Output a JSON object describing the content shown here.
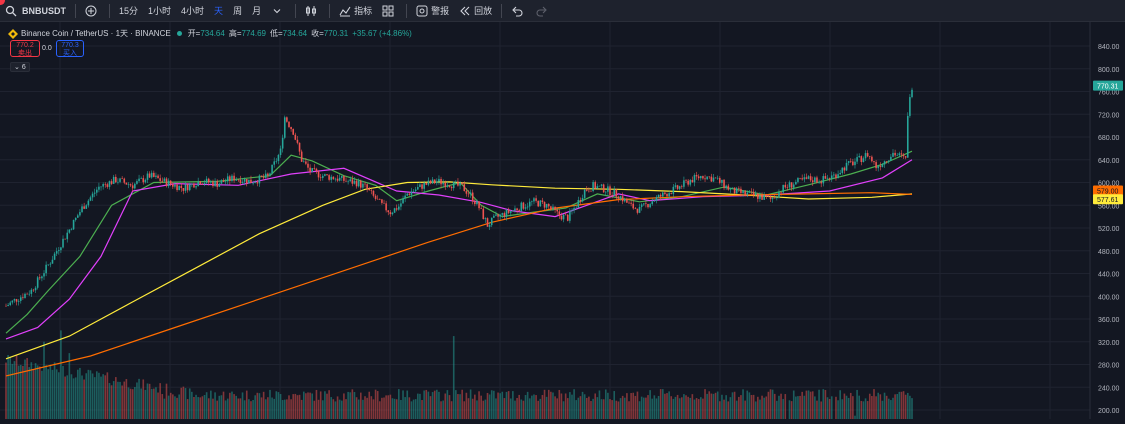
{
  "toolbar": {
    "symbol": "BNBUSDT",
    "intervals": [
      "15分",
      "1小时",
      "4小时",
      "天",
      "周",
      "月"
    ],
    "active_interval": "天",
    "indicators_label": "指标",
    "alert_label": "警报",
    "replay_label": "回放",
    "icons": [
      "search-icon",
      "add-compare-icon",
      "chevron-down-icon",
      "chart-type-icon",
      "indicators-icon",
      "layout-icon",
      "alert-icon",
      "replay-icon",
      "undo-icon",
      "redo-icon"
    ]
  },
  "legend": {
    "title": "Binance Coin / TetherUS · 1天 · BINANCE",
    "open_label": "开=",
    "open": "734.64",
    "high_label": "高=",
    "high": "774.69",
    "low_label": "低=",
    "low": "734.64",
    "close_label": "收=",
    "close": "770.31",
    "change": "+35.67 (+4.86%)"
  },
  "trade": {
    "sell_price": "770.2",
    "sell_label": "卖出",
    "spread": "0.0",
    "buy_price": "770.3",
    "buy_label": "买入",
    "collapse_label": "6"
  },
  "colors": {
    "up": "#26a69a",
    "down": "#ef5350",
    "ma1": "#4caf50",
    "ma2": "#e040fb",
    "ma3": "#ffeb3b",
    "ma4": "#ff6d00"
  },
  "chart_data": {
    "type": "candlestick",
    "y_axis": {
      "ticks": [
        840,
        800,
        760,
        720,
        680,
        640,
        600,
        560,
        520,
        480,
        440,
        400,
        360,
        320,
        280,
        240,
        200
      ],
      "range": [
        197,
        848
      ]
    },
    "last_price_labels": [
      {
        "value": "770.31",
        "color": "#26a69a"
      },
      {
        "value": "579.00",
        "color": "#ff6d00"
      },
      {
        "value": "577.61",
        "color": "#ffeb3b"
      }
    ],
    "candle_anchors": [
      [
        0,
        383
      ],
      [
        5,
        395
      ],
      [
        12,
        410
      ],
      [
        20,
        455
      ],
      [
        28,
        505
      ],
      [
        36,
        555
      ],
      [
        44,
        592
      ],
      [
        52,
        605
      ],
      [
        60,
        595
      ],
      [
        68,
        612
      ],
      [
        76,
        600
      ],
      [
        84,
        590
      ],
      [
        92,
        603
      ],
      [
        100,
        598
      ],
      [
        108,
        608
      ],
      [
        116,
        602
      ],
      [
        124,
        610
      ],
      [
        130,
        655
      ],
      [
        132,
        715
      ],
      [
        136,
        690
      ],
      [
        140,
        640
      ],
      [
        144,
        620
      ],
      [
        150,
        612
      ],
      [
        156,
        608
      ],
      [
        162,
        602
      ],
      [
        166,
        600
      ],
      [
        170,
        592
      ],
      [
        174,
        575
      ],
      [
        178,
        560
      ],
      [
        182,
        548
      ],
      [
        186,
        558
      ],
      [
        190,
        580
      ],
      [
        194,
        588
      ],
      [
        198,
        596
      ],
      [
        204,
        602
      ],
      [
        210,
        598
      ],
      [
        216,
        592
      ],
      [
        220,
        578
      ],
      [
        224,
        556
      ],
      [
        228,
        525
      ],
      [
        232,
        538
      ],
      [
        238,
        548
      ],
      [
        244,
        558
      ],
      [
        250,
        566
      ],
      [
        256,
        560
      ],
      [
        262,
        542
      ],
      [
        266,
        538
      ],
      [
        270,
        560
      ],
      [
        274,
        586
      ],
      [
        278,
        594
      ],
      [
        284,
        588
      ],
      [
        290,
        578
      ],
      [
        296,
        558
      ],
      [
        300,
        552
      ],
      [
        306,
        568
      ],
      [
        312,
        580
      ],
      [
        318,
        590
      ],
      [
        324,
        604
      ],
      [
        330,
        612
      ],
      [
        336,
        606
      ],
      [
        340,
        595
      ],
      [
        344,
        585
      ],
      [
        350,
        580
      ],
      [
        356,
        576
      ],
      [
        362,
        570
      ],
      [
        368,
        590
      ],
      [
        374,
        600
      ],
      [
        380,
        606
      ],
      [
        386,
        604
      ],
      [
        392,
        612
      ],
      [
        398,
        630
      ],
      [
        404,
        640
      ],
      [
        408,
        650
      ],
      [
        412,
        628
      ],
      [
        416,
        638
      ],
      [
        420,
        652
      ],
      [
        424,
        645
      ],
      [
        426,
        640
      ],
      [
        427,
        722
      ],
      [
        429,
        770
      ]
    ],
    "moving_averages": [
      {
        "color": "#4caf50",
        "points": [
          [
            0,
            335
          ],
          [
            10,
            368
          ],
          [
            20,
            410
          ],
          [
            35,
            470
          ],
          [
            50,
            560
          ],
          [
            70,
            600
          ],
          [
            100,
            602
          ],
          [
            125,
            612
          ],
          [
            135,
            648
          ],
          [
            145,
            638
          ],
          [
            160,
            612
          ],
          [
            175,
            595
          ],
          [
            185,
            568
          ],
          [
            200,
            585
          ],
          [
            215,
            600
          ],
          [
            225,
            560
          ],
          [
            235,
            540
          ],
          [
            250,
            548
          ],
          [
            265,
            555
          ],
          [
            280,
            580
          ],
          [
            300,
            566
          ],
          [
            320,
            575
          ],
          [
            340,
            592
          ],
          [
            360,
            578
          ],
          [
            380,
            596
          ],
          [
            400,
            615
          ],
          [
            415,
            632
          ],
          [
            429,
            655
          ]
        ]
      },
      {
        "color": "#e040fb",
        "points": [
          [
            0,
            325
          ],
          [
            15,
            345
          ],
          [
            30,
            395
          ],
          [
            45,
            470
          ],
          [
            60,
            585
          ],
          [
            80,
            598
          ],
          [
            110,
            595
          ],
          [
            135,
            615
          ],
          [
            160,
            625
          ],
          [
            185,
            585
          ],
          [
            205,
            578
          ],
          [
            225,
            565
          ],
          [
            240,
            550
          ],
          [
            260,
            540
          ],
          [
            275,
            560
          ],
          [
            290,
            580
          ],
          [
            305,
            568
          ],
          [
            330,
            575
          ],
          [
            360,
            578
          ],
          [
            390,
            585
          ],
          [
            415,
            608
          ],
          [
            429,
            640
          ]
        ]
      },
      {
        "color": "#ffeb3b",
        "points": [
          [
            0,
            290
          ],
          [
            30,
            330
          ],
          [
            60,
            390
          ],
          [
            90,
            450
          ],
          [
            120,
            510
          ],
          [
            150,
            560
          ],
          [
            170,
            588
          ],
          [
            190,
            600
          ],
          [
            210,
            601
          ],
          [
            230,
            596
          ],
          [
            260,
            590
          ],
          [
            290,
            588
          ],
          [
            320,
            584
          ],
          [
            350,
            578
          ],
          [
            380,
            571
          ],
          [
            410,
            574
          ],
          [
            429,
            580
          ]
        ]
      },
      {
        "color": "#ff6d00",
        "points": [
          [
            0,
            260
          ],
          [
            40,
            295
          ],
          [
            80,
            345
          ],
          [
            120,
            395
          ],
          [
            160,
            445
          ],
          [
            200,
            495
          ],
          [
            230,
            530
          ],
          [
            260,
            555
          ],
          [
            290,
            570
          ],
          [
            320,
            575
          ],
          [
            350,
            578
          ],
          [
            380,
            580
          ],
          [
            410,
            582
          ],
          [
            429,
            579
          ]
        ]
      }
    ],
    "volume_spikes": [
      [
        18,
        320
      ],
      [
        26,
        340
      ],
      [
        30,
        300
      ],
      [
        75,
        220
      ],
      [
        212,
        330
      ],
      [
        370,
        180
      ],
      [
        392,
        170
      ],
      [
        402,
        190
      ],
      [
        427,
        230
      ]
    ]
  }
}
